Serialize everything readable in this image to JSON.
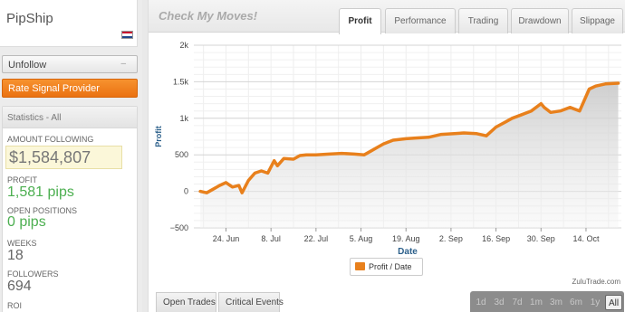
{
  "profile": {
    "name": "PipShip"
  },
  "actions": {
    "unfollow": "Unfollow",
    "unfollow_dash": "–",
    "rate": "Rate Signal Provider"
  },
  "stats": {
    "header": "Statistics - All",
    "amount_label": "AMOUNT FOLLOWING",
    "amount_value": "$1,584,807",
    "profit_label": "PROFIT",
    "profit_value": "1,581 pips",
    "open_label": "OPEN POSITIONS",
    "open_value": "0 pips",
    "weeks_label": "WEEKS",
    "weeks_value": "18",
    "followers_label": "FOLLOWERS",
    "followers_value": "694",
    "roi_label": "ROI"
  },
  "main": {
    "title": "Check My Moves!",
    "tabs": [
      "Profit",
      "Performance",
      "Trading",
      "Drawdown",
      "Slippage"
    ],
    "active_tab": "Profit",
    "legend": "Profit / Date",
    "credit": "ZuluTrade.com",
    "bottom_tabs": [
      "Open Trades",
      "Critical Events"
    ],
    "ranges": [
      "1d",
      "3d",
      "7d",
      "1m",
      "3m",
      "6m",
      "1y",
      "All"
    ],
    "active_range": "All"
  },
  "colors": {
    "accent": "#ea7212",
    "line": "#e8801c",
    "profit_green": "#4caf50"
  },
  "chart_data": {
    "type": "area",
    "xlabel": "Date",
    "ylabel": "Profit",
    "x_ticks": [
      "24. Jun",
      "8. Jul",
      "22. Jul",
      "5. Aug",
      "19. Aug",
      "2. Sep",
      "16. Sep",
      "30. Sep",
      "14. Oct"
    ],
    "y_ticks": [
      "−500",
      "0",
      "500",
      "1k",
      "1.5k",
      "2k"
    ],
    "ylim": [
      -500,
      2000
    ],
    "grid": true,
    "legend_position": "bottom-center",
    "series": [
      {
        "name": "Profit / Date",
        "x": [
          "2013-06-16",
          "2013-06-18",
          "2013-06-20",
          "2013-06-22",
          "2013-06-24",
          "2013-06-26",
          "2013-06-28",
          "2013-06-29",
          "2013-07-01",
          "2013-07-03",
          "2013-07-05",
          "2013-07-07",
          "2013-07-09",
          "2013-07-10",
          "2013-07-12",
          "2013-07-15",
          "2013-07-17",
          "2013-07-19",
          "2013-07-22",
          "2013-07-26",
          "2013-07-30",
          "2013-08-03",
          "2013-08-06",
          "2013-08-08",
          "2013-08-10",
          "2013-08-12",
          "2013-08-15",
          "2013-08-19",
          "2013-08-22",
          "2013-08-26",
          "2013-08-30",
          "2013-09-03",
          "2013-09-06",
          "2013-09-10",
          "2013-09-13",
          "2013-09-16",
          "2013-09-19",
          "2013-09-21",
          "2013-09-24",
          "2013-09-27",
          "2013-09-30",
          "2013-10-01",
          "2013-10-03",
          "2013-10-06",
          "2013-10-09",
          "2013-10-12",
          "2013-10-15",
          "2013-10-17",
          "2013-10-20",
          "2013-10-24"
        ],
        "values": [
          0,
          -20,
          30,
          80,
          120,
          60,
          80,
          -20,
          150,
          250,
          280,
          250,
          420,
          350,
          450,
          440,
          490,
          500,
          500,
          510,
          520,
          510,
          500,
          550,
          600,
          650,
          700,
          720,
          730,
          740,
          780,
          790,
          800,
          790,
          760,
          880,
          950,
          1000,
          1050,
          1100,
          1200,
          1150,
          1080,
          1100,
          1150,
          1100,
          1400,
          1440,
          1470,
          1480
        ]
      }
    ]
  }
}
